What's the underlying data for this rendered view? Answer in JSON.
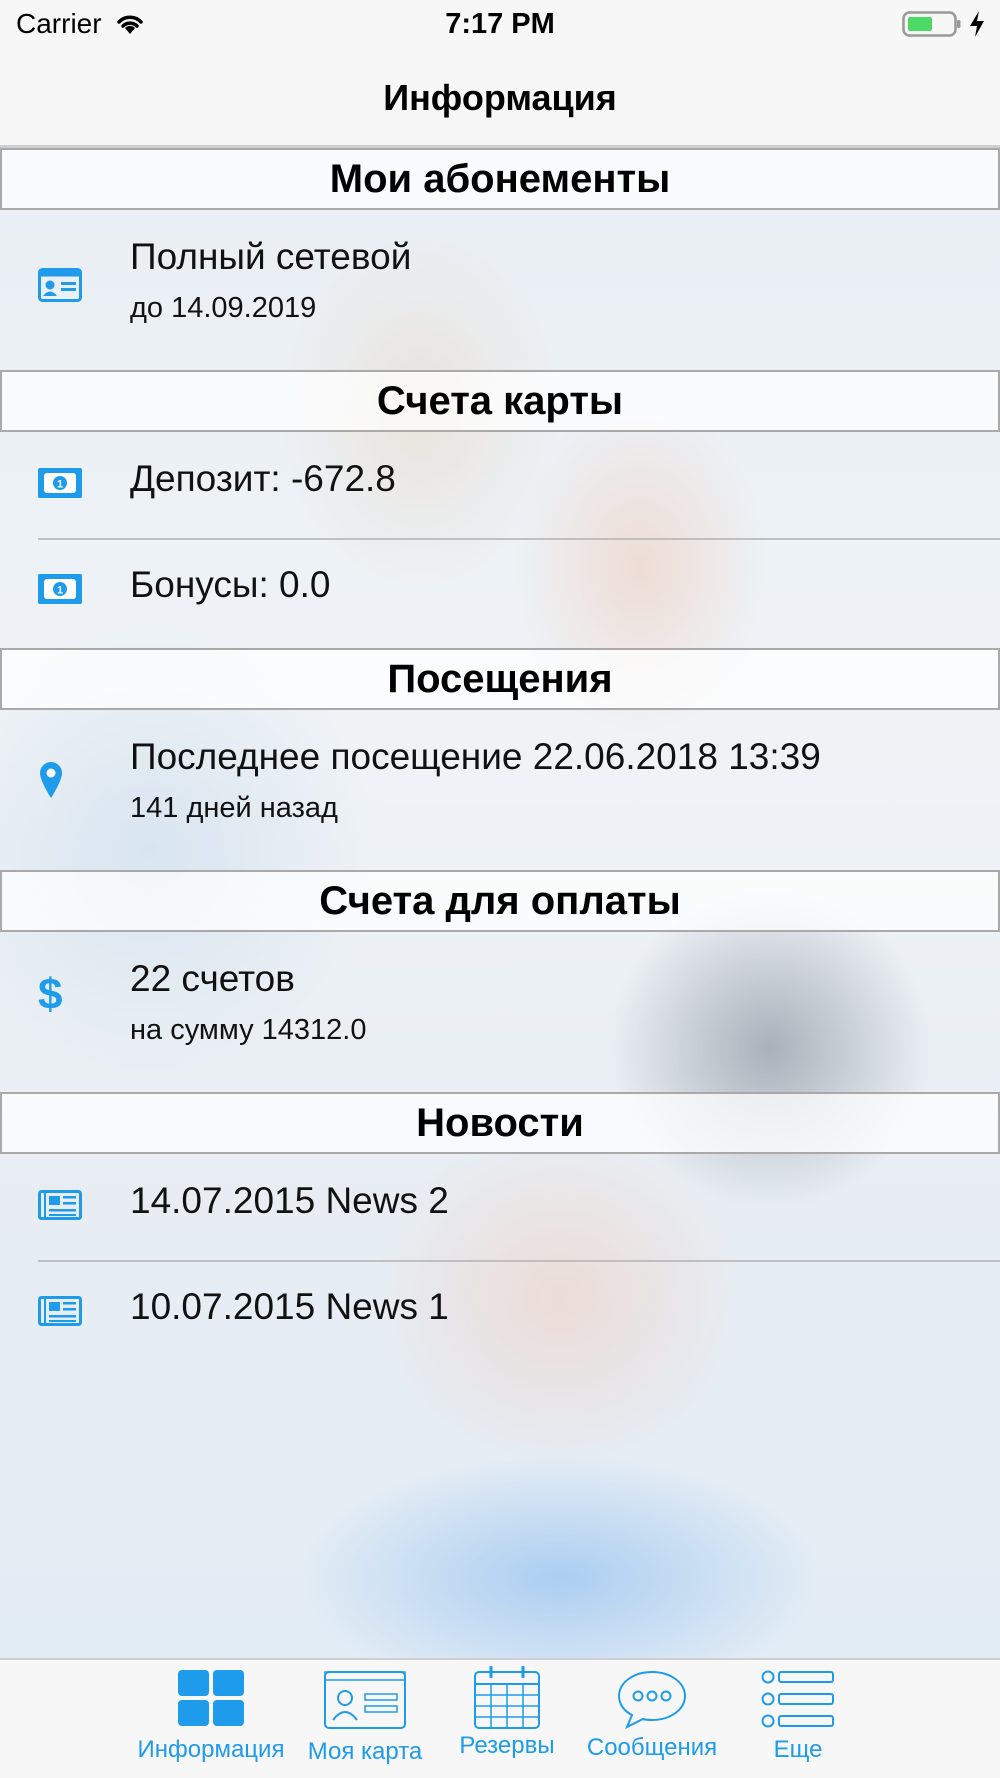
{
  "status_bar": {
    "carrier": "Carrier",
    "time": "7:17 PM"
  },
  "nav": {
    "title": "Информация"
  },
  "sections": {
    "subscriptions": {
      "header": "Мои абонементы",
      "item": {
        "title": "Полный сетевой",
        "subtitle": "до 14.09.2019",
        "icon": "id-card-icon"
      }
    },
    "card_accounts": {
      "header": "Счета карты",
      "items": [
        {
          "title": "Депозит: -672.8",
          "icon": "money-bill-icon"
        },
        {
          "title": "Бонусы: 0.0",
          "icon": "money-bill-icon"
        }
      ]
    },
    "visits": {
      "header": "Посещения",
      "item": {
        "title": "Последнее посещение 22.06.2018 13:39",
        "subtitle": "141 дней назад",
        "icon": "map-pin-icon"
      }
    },
    "invoices": {
      "header": "Счета для оплаты",
      "item": {
        "title": "22 счетов",
        "subtitle": "на сумму 14312.0",
        "icon": "dollar-icon"
      }
    },
    "news": {
      "header": "Новости",
      "items": [
        {
          "title": "14.07.2015 News 2",
          "icon": "newspaper-icon"
        },
        {
          "title": "10.07.2015 News 1",
          "icon": "newspaper-icon"
        }
      ]
    }
  },
  "tab_bar": {
    "tabs": [
      {
        "label": "Информация",
        "icon": "grid-icon",
        "active": true
      },
      {
        "label": "Моя карта",
        "icon": "card-icon"
      },
      {
        "label": "Резервы",
        "icon": "calendar-icon"
      },
      {
        "label": "Сообщения",
        "icon": "chat-icon"
      },
      {
        "label": "Еще",
        "icon": "list-icon"
      }
    ]
  },
  "colors": {
    "accent": "#1e9bea",
    "header_border": "#a9a9a9"
  }
}
